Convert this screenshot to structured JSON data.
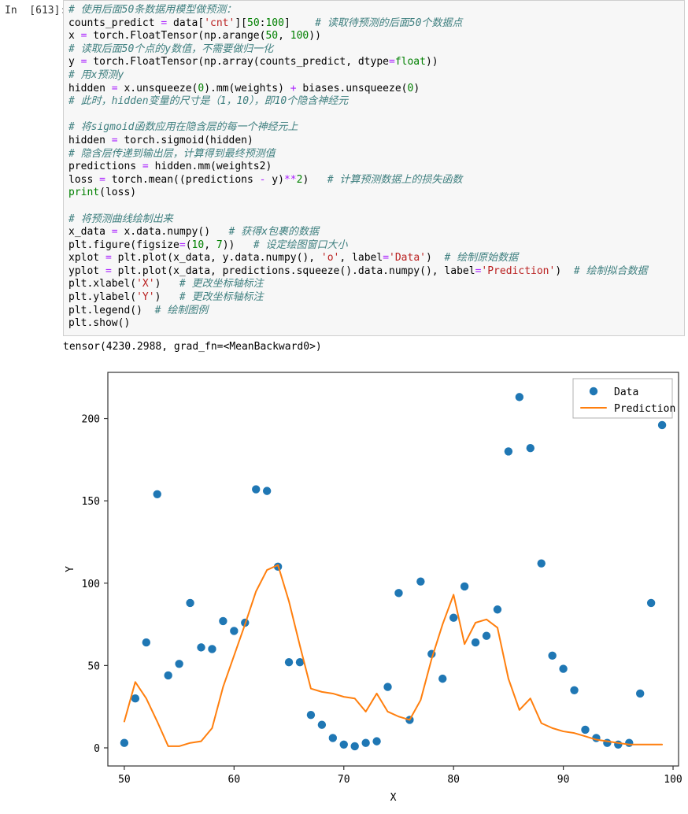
{
  "cell": {
    "prompt": "In  [613]:",
    "out_prompt": "",
    "lines": [
      {
        "t": "comment",
        "text": "# 使用后面50条数据用模型做预测："
      },
      {
        "t": "code",
        "segs": [
          {
            "c": "",
            "text": "counts_predict "
          },
          {
            "c": "op",
            "text": "="
          },
          {
            "c": "",
            "text": " data["
          },
          {
            "c": "str",
            "text": "'cnt'"
          },
          {
            "c": "",
            "text": "]["
          },
          {
            "c": "num",
            "text": "50"
          },
          {
            "c": "",
            "text": ":"
          },
          {
            "c": "num",
            "text": "100"
          },
          {
            "c": "",
            "text": "]    "
          },
          {
            "c": "cmt",
            "text": "# 读取待预测的后面50个数据点"
          }
        ]
      },
      {
        "t": "code",
        "segs": [
          {
            "c": "",
            "text": "x "
          },
          {
            "c": "op",
            "text": "="
          },
          {
            "c": "",
            "text": " torch.FloatTensor(np.arange("
          },
          {
            "c": "num",
            "text": "50"
          },
          {
            "c": "",
            "text": ", "
          },
          {
            "c": "num",
            "text": "100"
          },
          {
            "c": "",
            "text": "))"
          }
        ]
      },
      {
        "t": "comment",
        "text": "# 读取后面50个点的y数值，不需要做归一化"
      },
      {
        "t": "code",
        "segs": [
          {
            "c": "",
            "text": "y "
          },
          {
            "c": "op",
            "text": "="
          },
          {
            "c": "",
            "text": " torch.FloatTensor(np.array(counts_predict, dtype"
          },
          {
            "c": "op",
            "text": "="
          },
          {
            "c": "bi",
            "text": "float"
          },
          {
            "c": "",
            "text": "))"
          }
        ]
      },
      {
        "t": "comment",
        "text": "# 用x预测y"
      },
      {
        "t": "code",
        "segs": [
          {
            "c": "",
            "text": "hidden "
          },
          {
            "c": "op",
            "text": "="
          },
          {
            "c": "",
            "text": " x.unsqueeze("
          },
          {
            "c": "num",
            "text": "0"
          },
          {
            "c": "",
            "text": ").mm(weights) "
          },
          {
            "c": "op",
            "text": "+"
          },
          {
            "c": "",
            "text": " biases.unsqueeze("
          },
          {
            "c": "num",
            "text": "0"
          },
          {
            "c": "",
            "text": ")"
          }
        ]
      },
      {
        "t": "comment",
        "text": "# 此时，hidden变量的尺寸是（1，10），即10个隐含神经元"
      },
      {
        "t": "blank",
        "text": ""
      },
      {
        "t": "comment",
        "text": "# 将sigmoid函数应用在隐含层的每一个神经元上"
      },
      {
        "t": "code",
        "segs": [
          {
            "c": "",
            "text": "hidden "
          },
          {
            "c": "op",
            "text": "="
          },
          {
            "c": "",
            "text": " torch.sigmoid(hidden)"
          }
        ]
      },
      {
        "t": "comment",
        "text": "# 隐含层传递到输出层，计算得到最终预测值"
      },
      {
        "t": "code",
        "segs": [
          {
            "c": "",
            "text": "predictions "
          },
          {
            "c": "op",
            "text": "="
          },
          {
            "c": "",
            "text": " hidden.mm(weights2)"
          }
        ]
      },
      {
        "t": "code",
        "segs": [
          {
            "c": "",
            "text": "loss "
          },
          {
            "c": "op",
            "text": "="
          },
          {
            "c": "",
            "text": " torch.mean((predictions "
          },
          {
            "c": "op",
            "text": "-"
          },
          {
            "c": "",
            "text": " y)"
          },
          {
            "c": "op",
            "text": "**"
          },
          {
            "c": "num",
            "text": "2"
          },
          {
            "c": "",
            "text": ")   "
          },
          {
            "c": "cmt",
            "text": "# 计算预测数据上的损失函数"
          }
        ]
      },
      {
        "t": "code",
        "segs": [
          {
            "c": "fn",
            "text": "print"
          },
          {
            "c": "",
            "text": "(loss)"
          }
        ]
      },
      {
        "t": "blank",
        "text": ""
      },
      {
        "t": "comment",
        "text": "# 将预测曲线绘制出来"
      },
      {
        "t": "code",
        "segs": [
          {
            "c": "",
            "text": "x_data "
          },
          {
            "c": "op",
            "text": "="
          },
          {
            "c": "",
            "text": " x.data.numpy()   "
          },
          {
            "c": "cmt",
            "text": "# 获得x包裹的数据"
          }
        ]
      },
      {
        "t": "code",
        "segs": [
          {
            "c": "",
            "text": "plt.figure(figsize"
          },
          {
            "c": "op",
            "text": "="
          },
          {
            "c": "",
            "text": "("
          },
          {
            "c": "num",
            "text": "10"
          },
          {
            "c": "",
            "text": ", "
          },
          {
            "c": "num",
            "text": "7"
          },
          {
            "c": "",
            "text": "))   "
          },
          {
            "c": "cmt",
            "text": "# 设定绘图窗口大小"
          }
        ]
      },
      {
        "t": "code",
        "segs": [
          {
            "c": "",
            "text": "xplot "
          },
          {
            "c": "op",
            "text": "="
          },
          {
            "c": "",
            "text": " plt.plot(x_data, y.data.numpy(), "
          },
          {
            "c": "str",
            "text": "'o'"
          },
          {
            "c": "",
            "text": ", label"
          },
          {
            "c": "op",
            "text": "="
          },
          {
            "c": "str",
            "text": "'Data'"
          },
          {
            "c": "",
            "text": ")  "
          },
          {
            "c": "cmt",
            "text": "# 绘制原始数据"
          }
        ]
      },
      {
        "t": "code",
        "segs": [
          {
            "c": "",
            "text": "yplot "
          },
          {
            "c": "op",
            "text": "="
          },
          {
            "c": "",
            "text": " plt.plot(x_data, predictions.squeeze().data.numpy(), label"
          },
          {
            "c": "op",
            "text": "="
          },
          {
            "c": "str",
            "text": "'Prediction'"
          },
          {
            "c": "",
            "text": ")  "
          },
          {
            "c": "cmt",
            "text": "# 绘制拟合数据"
          }
        ]
      },
      {
        "t": "code",
        "segs": [
          {
            "c": "",
            "text": "plt.xlabel("
          },
          {
            "c": "str",
            "text": "'X'"
          },
          {
            "c": "",
            "text": ")   "
          },
          {
            "c": "cmt",
            "text": "# 更改坐标轴标注"
          }
        ]
      },
      {
        "t": "code",
        "segs": [
          {
            "c": "",
            "text": "plt.ylabel("
          },
          {
            "c": "str",
            "text": "'Y'"
          },
          {
            "c": "",
            "text": ")   "
          },
          {
            "c": "cmt",
            "text": "# 更改坐标轴标注"
          }
        ]
      },
      {
        "t": "code",
        "segs": [
          {
            "c": "",
            "text": "plt.legend()  "
          },
          {
            "c": "cmt",
            "text": "# 绘制图例"
          }
        ]
      },
      {
        "t": "code",
        "segs": [
          {
            "c": "",
            "text": "plt.show()"
          }
        ]
      }
    ],
    "output_text": "tensor(4230.2988, grad_fn=<MeanBackward0>)"
  },
  "chart_data": {
    "type": "scatter",
    "title": "",
    "xlabel": "X",
    "ylabel": "Y",
    "xlim": [
      48.5,
      100.5
    ],
    "ylim": [
      -11,
      228
    ],
    "xticks": [
      50,
      60,
      70,
      80,
      90,
      100
    ],
    "yticks": [
      0,
      50,
      100,
      150,
      200
    ],
    "grid": false,
    "legend_position": "upper right",
    "colors": {
      "data": "#1f77b4",
      "prediction": "#ff7f0e",
      "axes": "#333333",
      "background": "#ffffff"
    },
    "series": [
      {
        "name": "Data",
        "type": "scatter",
        "marker": "o",
        "color": "#1f77b4",
        "x": [
          50,
          51,
          52,
          53,
          54,
          55,
          56,
          57,
          58,
          59,
          60,
          61,
          62,
          63,
          64,
          65,
          66,
          67,
          68,
          69,
          70,
          71,
          72,
          73,
          74,
          75,
          76,
          77,
          78,
          79,
          80,
          81,
          82,
          83,
          84,
          85,
          86,
          87,
          88,
          89,
          90,
          91,
          92,
          93,
          94,
          95,
          96,
          97,
          98,
          99
        ],
        "y": [
          3,
          30,
          64,
          154,
          44,
          51,
          88,
          61,
          60,
          77,
          71,
          76,
          157,
          156,
          110,
          52,
          52,
          20,
          14,
          6,
          2,
          1,
          3,
          4,
          37,
          94,
          17,
          101,
          57,
          42,
          79,
          98,
          64,
          68,
          84,
          180,
          213,
          182,
          112,
          56,
          48,
          35,
          11,
          6,
          3,
          2,
          3,
          33,
          88,
          196
        ]
      },
      {
        "name": "Prediction",
        "type": "line",
        "color": "#ff7f0e",
        "x": [
          50,
          51,
          52,
          53,
          54,
          55,
          56,
          57,
          58,
          59,
          60,
          61,
          62,
          63,
          64,
          65,
          66,
          67,
          68,
          69,
          70,
          71,
          72,
          73,
          74,
          75,
          76,
          77,
          78,
          79,
          80,
          81,
          82,
          83,
          84,
          85,
          86,
          87,
          88,
          89,
          90,
          91,
          92,
          93,
          94,
          95,
          96,
          97,
          98,
          99
        ],
        "y": [
          16,
          40,
          30,
          16,
          1,
          1,
          3,
          4,
          12,
          37,
          56,
          75,
          95,
          108,
          111,
          89,
          62,
          36,
          34,
          33,
          31,
          30,
          22,
          33,
          22,
          19,
          17,
          29,
          54,
          75,
          93,
          63,
          76,
          78,
          73,
          42,
          23,
          30,
          15,
          12,
          10,
          9,
          7,
          5,
          4,
          3,
          2,
          2,
          2,
          2
        ]
      }
    ],
    "legend": [
      {
        "label": "Data",
        "marker": "circle",
        "color": "#1f77b4"
      },
      {
        "label": "Prediction",
        "marker": "line",
        "color": "#ff7f0e"
      }
    ]
  }
}
